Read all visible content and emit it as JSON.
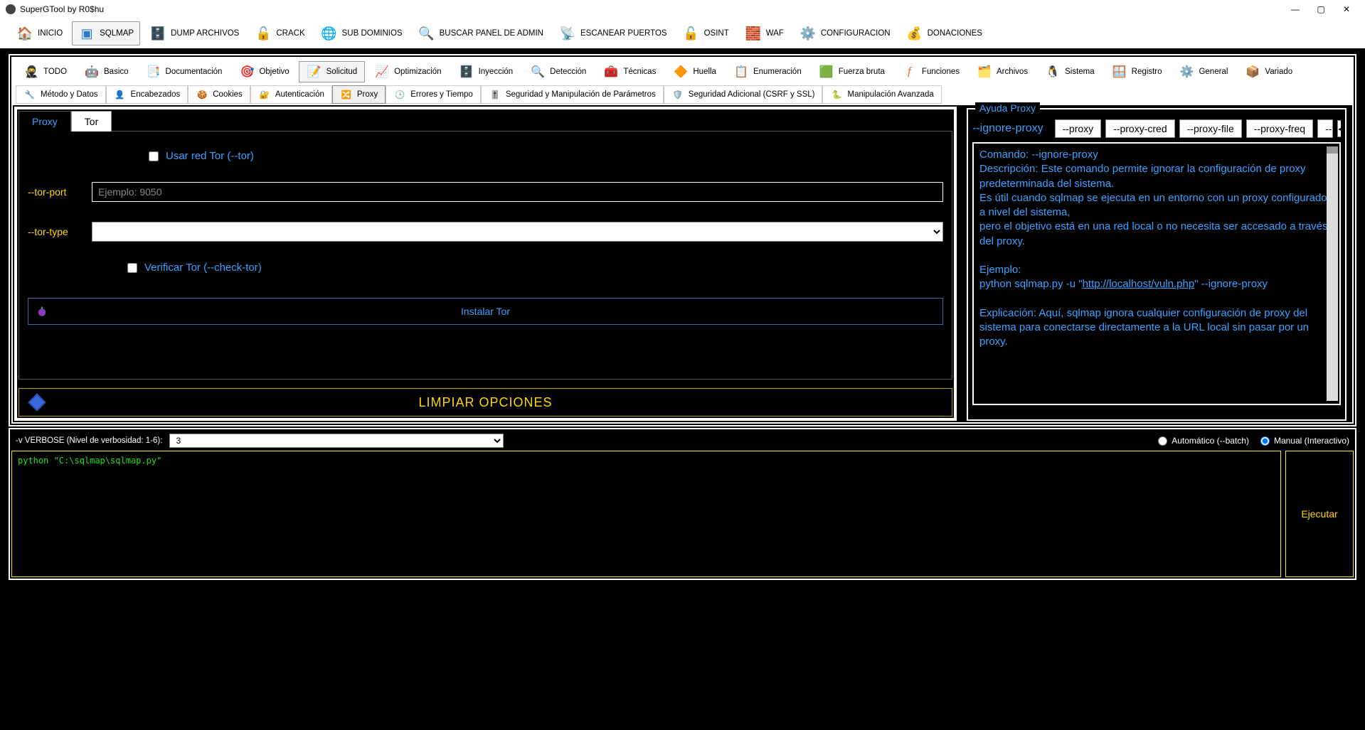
{
  "titlebar": {
    "title": "SuperGTool by R0$hu"
  },
  "main_toolbar": [
    {
      "label": "INICIO"
    },
    {
      "label": "SQLMAP",
      "active": true
    },
    {
      "label": "DUMP ARCHIVOS"
    },
    {
      "label": "CRACK"
    },
    {
      "label": "SUB DOMINIOS"
    },
    {
      "label": "BUSCAR PANEL DE ADMIN"
    },
    {
      "label": "ESCANEAR PUERTOS"
    },
    {
      "label": "OSINT"
    },
    {
      "label": "WAF"
    },
    {
      "label": "CONFIGURACION"
    },
    {
      "label": "DONACIONES"
    }
  ],
  "sec_toolbar": [
    {
      "label": "TODO"
    },
    {
      "label": "Basico"
    },
    {
      "label": "Documentación"
    },
    {
      "label": "Objetivo"
    },
    {
      "label": "Solicitud",
      "active": true
    },
    {
      "label": "Optimización"
    },
    {
      "label": "Inyección"
    },
    {
      "label": "Detección"
    },
    {
      "label": "Técnicas"
    },
    {
      "label": "Huella"
    },
    {
      "label": "Enumeración"
    },
    {
      "label": "Fuerza bruta"
    },
    {
      "label": "Funciones"
    },
    {
      "label": "Archivos"
    },
    {
      "label": "Sistema"
    },
    {
      "label": "Registro"
    },
    {
      "label": "General"
    },
    {
      "label": "Variado"
    }
  ],
  "ter_toolbar": [
    {
      "label": "Método y Datos"
    },
    {
      "label": "Encabezados"
    },
    {
      "label": "Cookies"
    },
    {
      "label": "Autenticación"
    },
    {
      "label": "Proxy",
      "active": true
    },
    {
      "label": "Errores y Tiempo"
    },
    {
      "label": "Seguridad y Manipulación de Parámetros"
    },
    {
      "label": "Seguridad Adicional (CSRF y SSL)"
    },
    {
      "label": "Manipulación Avanzada"
    }
  ],
  "pt_tabs": {
    "proxy": "Proxy",
    "tor": "Tor"
  },
  "tor_panel": {
    "use_tor": "Usar red Tor (--tor)",
    "tor_port_label": "--tor-port",
    "tor_port_placeholder": "Ejemplo: 9050",
    "tor_type_label": "--tor-type",
    "check_tor": "Verificar Tor (--check-tor)",
    "install_btn": "Instalar Tor"
  },
  "clear_btn": "LIMPIAR OPCIONES",
  "help": {
    "legend": "Ayuda Proxy",
    "tabs": [
      "--ignore-proxy",
      "--proxy",
      "--proxy-cred",
      "--proxy-file",
      "--proxy-freq",
      "--tc"
    ],
    "body": {
      "l1": "Comando: --ignore-proxy",
      "l2": "Descripción: Este comando permite ignorar la configuración de proxy predeterminada del sistema.",
      "l3a": "Es útil cuando sqlmap se ejecuta en un entorno con un proxy configurado a nivel del sistema,",
      "l3b": "pero el objetivo está en una red local o no necesita ser accesado a través del proxy.",
      "l4": "Ejemplo:",
      "l5a": "python sqlmap.py -u \"",
      "l5link": "http://localhost/vuln.php",
      "l5b": "\" --ignore-proxy",
      "l6": "Explicación: Aquí, sqlmap ignora cualquier configuración de proxy del sistema para conectarse directamente a la URL local sin pasar por un proxy."
    }
  },
  "verbose_label": "-v VERBOSE (Nivel de verbosidad: 1-6):",
  "verbose_value": "3",
  "mode": {
    "auto": "Automático (--batch)",
    "manual": "Manual (Interactivo)"
  },
  "console_text": "python \"C:\\sqlmap\\sqlmap.py\"",
  "exec_btn": "Ejecutar"
}
